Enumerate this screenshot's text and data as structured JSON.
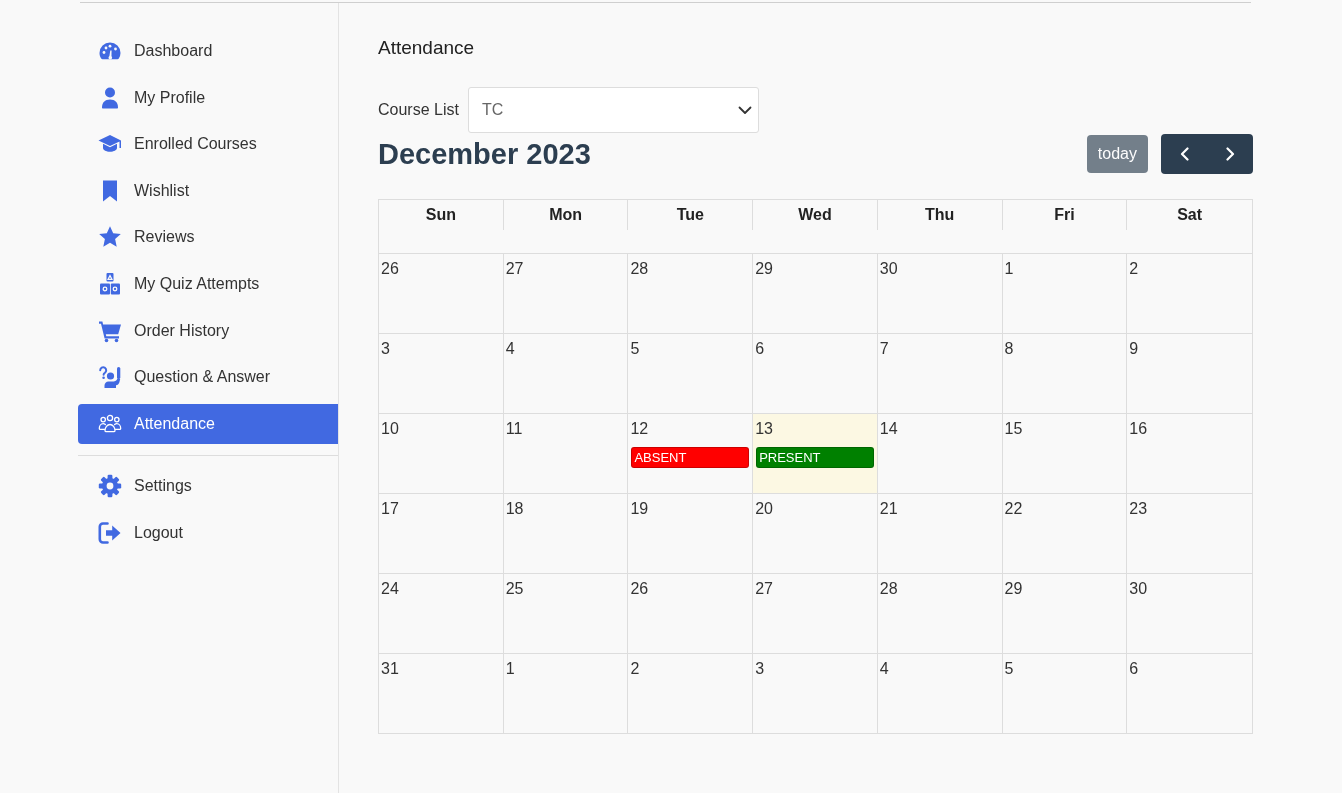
{
  "sidebar": {
    "items": [
      {
        "label": "Dashboard",
        "selected": false
      },
      {
        "label": "My Profile",
        "selected": false
      },
      {
        "label": "Enrolled Courses",
        "selected": false
      },
      {
        "label": "Wishlist",
        "selected": false
      },
      {
        "label": "Reviews",
        "selected": false
      },
      {
        "label": "My Quiz Attempts",
        "selected": false
      },
      {
        "label": "Order History",
        "selected": false
      },
      {
        "label": "Question & Answer",
        "selected": false
      },
      {
        "label": "Attendance",
        "selected": true
      }
    ],
    "bottom_items": [
      {
        "label": "Settings",
        "selected": false
      },
      {
        "label": "Logout",
        "selected": false
      }
    ]
  },
  "page_title": "Attendance",
  "course_select": {
    "label": "Course List",
    "value": "TC"
  },
  "calendar": {
    "title": "December 2023",
    "today_button": {
      "label": "today",
      "disabled": true
    },
    "weekdays": [
      "Sun",
      "Mon",
      "Tue",
      "Wed",
      "Thu",
      "Fri",
      "Sat"
    ],
    "weeks": [
      [
        {
          "day": "26",
          "today": false
        },
        {
          "day": "27",
          "today": false
        },
        {
          "day": "28",
          "today": false
        },
        {
          "day": "29",
          "today": false
        },
        {
          "day": "30",
          "today": false
        },
        {
          "day": "1",
          "today": false
        },
        {
          "day": "2",
          "today": false
        }
      ],
      [
        {
          "day": "3",
          "today": false
        },
        {
          "day": "4",
          "today": false
        },
        {
          "day": "5",
          "today": false
        },
        {
          "day": "6",
          "today": false
        },
        {
          "day": "7",
          "today": false
        },
        {
          "day": "8",
          "today": false
        },
        {
          "day": "9",
          "today": false
        }
      ],
      [
        {
          "day": "10",
          "today": false
        },
        {
          "day": "11",
          "today": false
        },
        {
          "day": "12",
          "today": false,
          "events": [
            {
              "label": "ABSENT",
              "color": "#ff0000"
            }
          ]
        },
        {
          "day": "13",
          "today": true,
          "events": [
            {
              "label": "PRESENT",
              "color": "#008000"
            }
          ]
        },
        {
          "day": "14",
          "today": false
        },
        {
          "day": "15",
          "today": false
        },
        {
          "day": "16",
          "today": false
        }
      ],
      [
        {
          "day": "17",
          "today": false
        },
        {
          "day": "18",
          "today": false
        },
        {
          "day": "19",
          "today": false
        },
        {
          "day": "20",
          "today": false
        },
        {
          "day": "21",
          "today": false
        },
        {
          "day": "22",
          "today": false
        },
        {
          "day": "23",
          "today": false
        }
      ],
      [
        {
          "day": "24",
          "today": false
        },
        {
          "day": "25",
          "today": false
        },
        {
          "day": "26",
          "today": false
        },
        {
          "day": "27",
          "today": false
        },
        {
          "day": "28",
          "today": false
        },
        {
          "day": "29",
          "today": false
        },
        {
          "day": "30",
          "today": false
        }
      ],
      [
        {
          "day": "31",
          "today": false
        },
        {
          "day": "1",
          "today": false
        },
        {
          "day": "2",
          "today": false
        },
        {
          "day": "3",
          "today": false
        },
        {
          "day": "4",
          "today": false
        },
        {
          "day": "5",
          "today": false
        },
        {
          "day": "6",
          "today": false
        }
      ]
    ]
  }
}
